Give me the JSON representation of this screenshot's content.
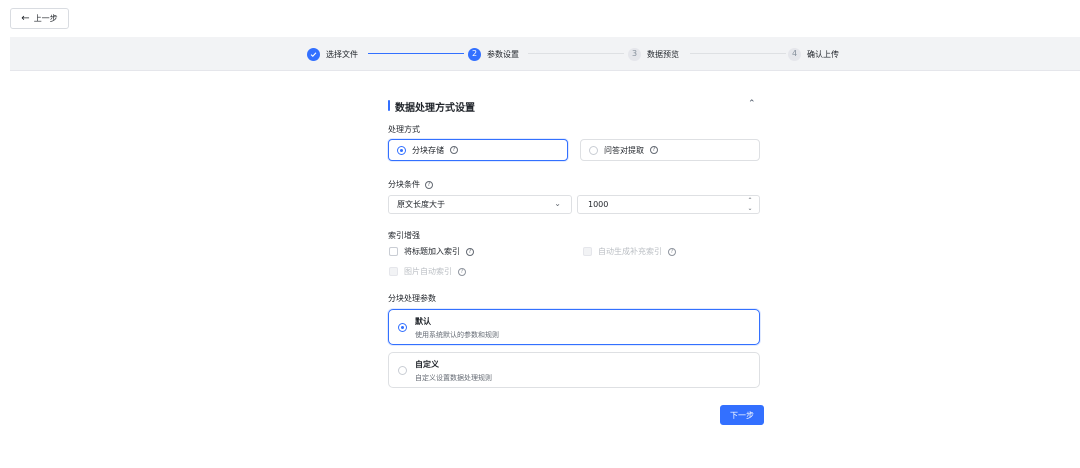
{
  "back_button": {
    "label": "上一步"
  },
  "steps": [
    {
      "number": "",
      "label": "选择文件",
      "state": "done"
    },
    {
      "number": "2",
      "label": "参数设置",
      "state": "active"
    },
    {
      "number": "3",
      "label": "数据预览",
      "state": "todo"
    },
    {
      "number": "4",
      "label": "确认上传",
      "state": "todo"
    }
  ],
  "section": {
    "title": "数据处理方式设置"
  },
  "processing_mode": {
    "label": "处理方式",
    "options": [
      {
        "label": "分块存储",
        "selected": true
      },
      {
        "label": "问答对提取",
        "selected": false
      }
    ]
  },
  "chunk_condition": {
    "label": "分块条件",
    "select_value": "原文长度大于",
    "number_value": "1000"
  },
  "index_enhance": {
    "label": "索引增强",
    "options": [
      {
        "label": "将标题加入索引",
        "checked": false,
        "disabled": false
      },
      {
        "label": "自动生成补充索引",
        "checked": false,
        "disabled": true
      },
      {
        "label": "图片自动索引",
        "checked": false,
        "disabled": true
      }
    ]
  },
  "chunk_params": {
    "label": "分块处理参数",
    "options": [
      {
        "title": "默认",
        "desc": "使用系统默认的参数和规则",
        "selected": true
      },
      {
        "title": "自定义",
        "desc": "自定义设置数据处理规则",
        "selected": false
      }
    ]
  },
  "next_button": {
    "label": "下一步"
  },
  "colors": {
    "primary": "#3370ff",
    "border": "#dee0e3",
    "steps_bg": "#f2f3f5"
  }
}
